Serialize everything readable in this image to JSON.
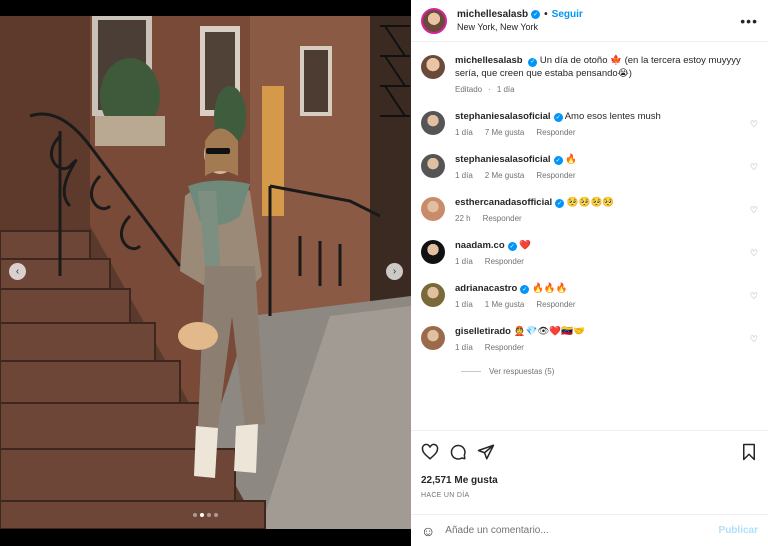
{
  "post": {
    "username": "michellesalasb",
    "follow_label": "Seguir",
    "location": "New York, New York",
    "more_label": "•••",
    "caption": "Un día de otoño 🍁 (en la tercera estoy muyyyy sería, que creen que estaba pensando😭)",
    "caption_edited": "Editado",
    "caption_time": "1 día"
  },
  "comments": [
    {
      "user": "stephaniesalasoficial",
      "verified": true,
      "text": "Amo esos lentes mush",
      "time": "1 día",
      "likes": "7 Me gusta",
      "reply": "Responder"
    },
    {
      "user": "stephaniesalasoficial",
      "verified": true,
      "text": "🔥",
      "time": "1 día",
      "likes": "2 Me gusta",
      "reply": "Responder"
    },
    {
      "user": "esthercanadasofficial",
      "verified": true,
      "text": "🥺🥺🥺🥺",
      "time": "22 h",
      "likes": "",
      "reply": "Responder"
    },
    {
      "user": "naadam.co",
      "verified": true,
      "text": "❤️",
      "time": "1 día",
      "likes": "",
      "reply": "Responder"
    },
    {
      "user": "adrianacastro",
      "verified": true,
      "text": "🔥🔥🔥",
      "time": "1 día",
      "likes": "1 Me gusta",
      "reply": "Responder"
    },
    {
      "user": "giselletirado",
      "verified": false,
      "text": "👲💎👁❤️🇻🇪🤝",
      "time": "1 día",
      "likes": "",
      "reply": "Responder"
    }
  ],
  "view_replies": "Ver respuestas (5)",
  "likes_count": "22,571 Me gusta",
  "post_date": "HACE UN DÍA",
  "add_comment_placeholder": "Añade un comentario...",
  "publish_label": "Publicar",
  "carousel": {
    "slides": 4,
    "active_index": 1
  }
}
